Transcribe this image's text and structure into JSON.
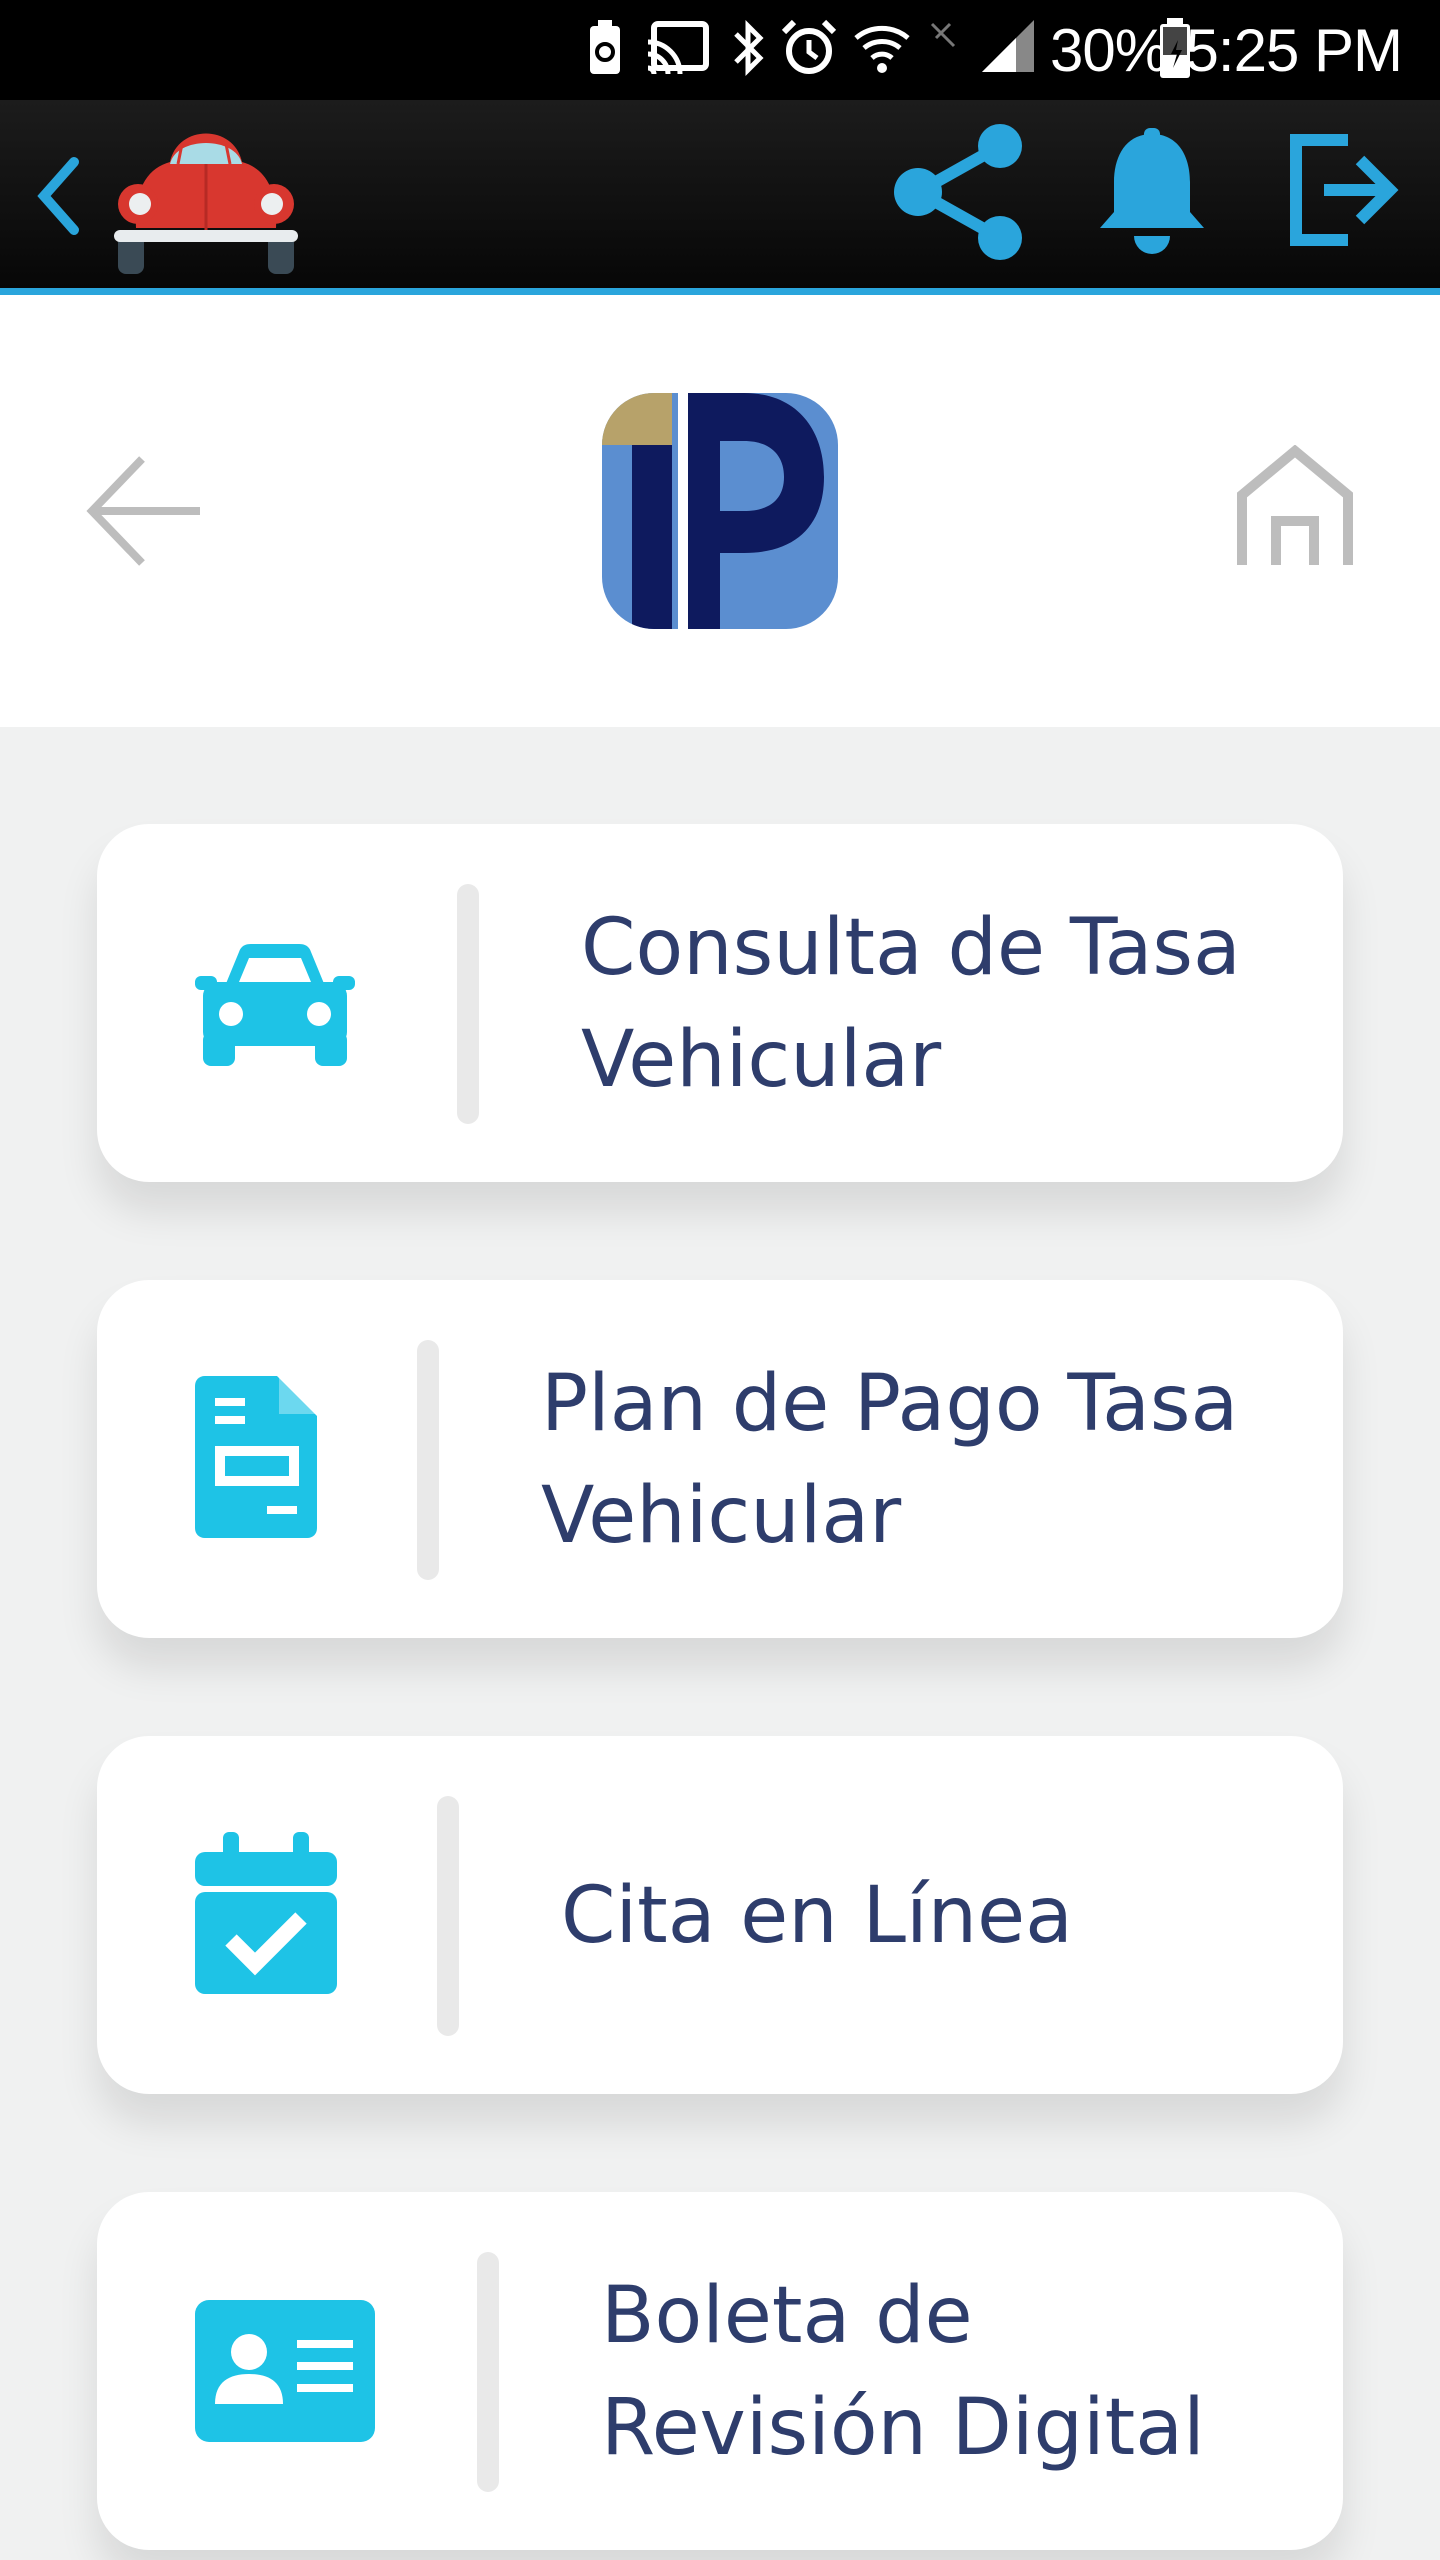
{
  "status_bar": {
    "battery_percent": "30%",
    "time": "5:25 PM"
  },
  "toolbar": {
    "back_icon": "chevron-left-icon",
    "logo": "red-beetle-car-logo",
    "share_icon": "share-icon",
    "bell_icon": "bell-icon",
    "logout_icon": "logout-icon",
    "accent_color": "#2aa5dc"
  },
  "header": {
    "back_icon": "arrow-left-icon",
    "logo": "ip-logo",
    "home_icon": "home-icon"
  },
  "menu": {
    "items": [
      {
        "label_line1": "Consulta de Tasa",
        "label_line2": "Vehicular",
        "icon": "car-icon"
      },
      {
        "label_line1": "Plan de Pago Tasa",
        "label_line2": "Vehicular",
        "icon": "document-icon"
      },
      {
        "label_line1": "Cita en Línea",
        "label_line2": "",
        "icon": "calendar-check-icon"
      },
      {
        "label_line1": "Boleta de",
        "label_line2": "Revisión Digital",
        "icon": "id-card-icon"
      }
    ]
  },
  "colors": {
    "icon_cyan": "#1ec3e6",
    "text_navy": "#2e3d6c",
    "background": "#f0f1f1"
  }
}
